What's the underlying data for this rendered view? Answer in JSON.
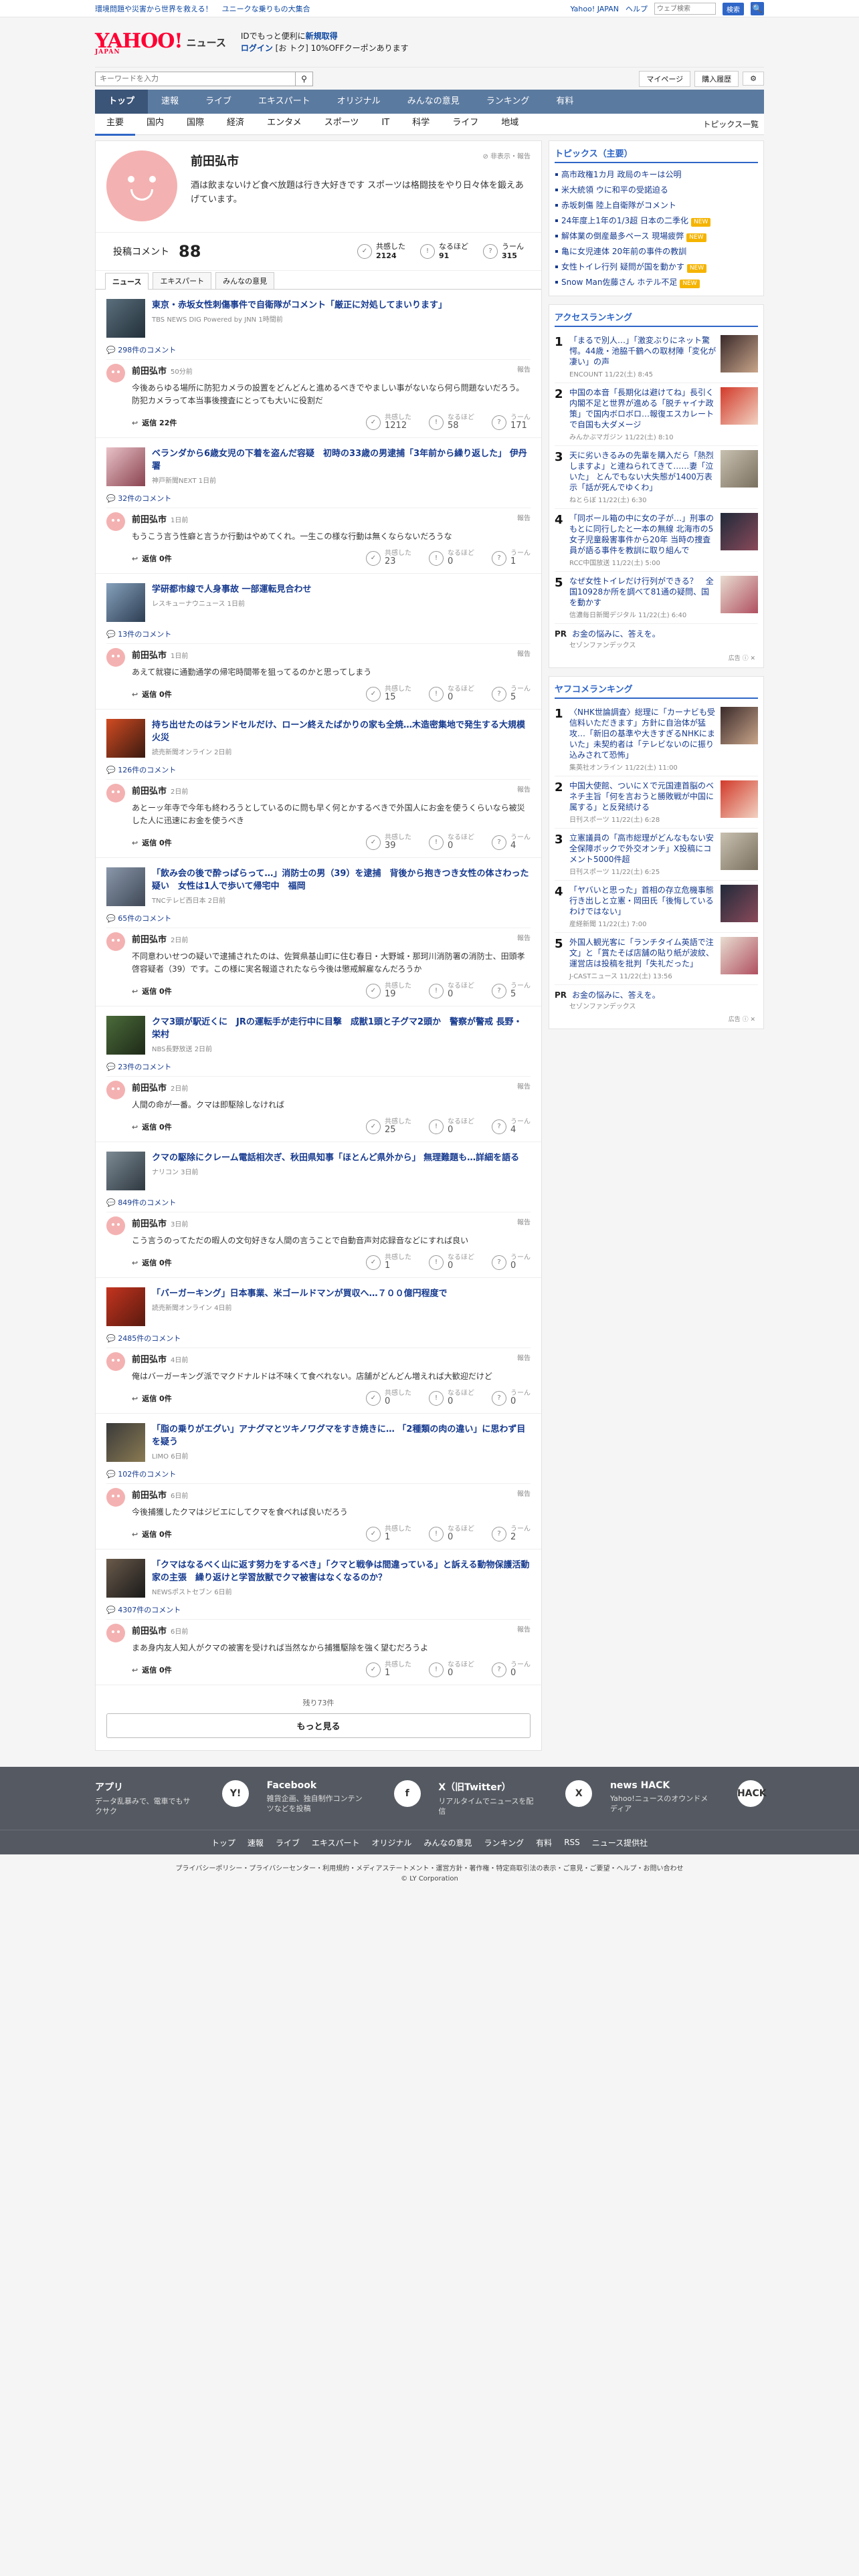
{
  "topbar": {
    "left": [
      "環境問題や災害から世界を救える！",
      "ユニークな乗りもの大集合"
    ],
    "right_links": [
      "Yahoo! JAPAN",
      "ヘルプ"
    ],
    "search_placeholder": "ウェブ検索",
    "search_btn": "検索",
    "search_icon_label": "🔍"
  },
  "masthead": {
    "logo": "YAHOO!",
    "logo_sub": "JAPAN",
    "section": "ニュース",
    "promo_line1_a": "IDでもっと便利に",
    "promo_line1_b": "新規取得",
    "promo_line2_a": "ログイン",
    "promo_line2_b": "[お トク] 10%OFFクーポンあります"
  },
  "search": {
    "placeholder": "キーワードを入力",
    "mypage": "マイページ",
    "history": "購入履歴",
    "gear": "⚙"
  },
  "globalnav": [
    "トップ",
    "速報",
    "ライブ",
    "エキスパート",
    "オリジナル",
    "みんなの意見",
    "ランキング",
    "有料"
  ],
  "subnav": {
    "items": [
      "主要",
      "国内",
      "国際",
      "経済",
      "エンタメ",
      "スポーツ",
      "IT",
      "科学",
      "ライフ",
      "地域"
    ],
    "right": "トピックス一覧"
  },
  "profile": {
    "name": "前田弘市",
    "bio": "酒は飲まないけど食べ放題は行き大好きです スポーツは格闘技をやり日々体を鍛えあげています。",
    "action": "⊘ 非表示・報告"
  },
  "stats": {
    "label": "投稿コメント",
    "count": "88",
    "items": [
      {
        "label": "共感した",
        "value": "2124"
      },
      {
        "label": "なるほど",
        "value": "91"
      },
      {
        "label": "うーん",
        "value": "315"
      }
    ]
  },
  "tabs": [
    "ニュース",
    "エキスパート",
    "みんなの意見"
  ],
  "common": {
    "reply": "返信",
    "report": "報告",
    "react_labels": [
      "共感した",
      "なるほど",
      "うーん"
    ],
    "author": "前田弘市"
  },
  "entries": [
    {
      "title": "東京・赤坂女性刺傷事件で自衛隊がコメント「厳正に対処してまいります」",
      "src": "TBS NEWS DIG Powered by JNN 1時間前",
      "ccount": "298件のコメント",
      "time": "50分前",
      "text": "今後あらゆる場所に防犯カメラの設置をどんどんと進めるべきでやましい事がないなら何ら問題ないだろう。防犯カメラって本当事後捜査にとっても大いに役割だ",
      "reply": "返信 22件",
      "r": [
        "1212",
        "58",
        "171"
      ]
    },
    {
      "title": "ベランダから6歳女児の下着を盗んだ容疑　初時の33歳の男逮捕「3年前から繰り返した」 伊丹署",
      "src": "神戸新聞NEXT 1日前",
      "ccount": "32件のコメント",
      "time": "1日前",
      "text": "もうこう言う性癖と言うか行動はやめてくれ。一生この様な行動は無くならないだろうな",
      "reply": "返信 0件",
      "r": [
        "23",
        "0",
        "1"
      ]
    },
    {
      "title": "学研都市線で人身事故 一部運転見合わせ",
      "src": "レスキューナウニュース 1日前",
      "ccount": "13件のコメント",
      "time": "1日前",
      "text": "あえて就寝に通勤通学の帰宅時間帯を狙ってるのかと思ってしまう",
      "reply": "返信 0件",
      "r": [
        "15",
        "0",
        "5"
      ]
    },
    {
      "title": "持ち出せたのはランドセルだけ、ローン終えたばかりの家も全焼…木造密集地で発生する大規模火災",
      "src": "読売新聞オンライン 2日前",
      "ccount": "126件のコメント",
      "time": "2日前",
      "text": "あとーッ年寺で今年も終わろうとしているのに問も早く何とかするべきで外国人にお金を使うくらいなら被災した人に迅速にお金を使うべき",
      "reply": "返信 0件",
      "r": [
        "39",
        "0",
        "4"
      ]
    },
    {
      "title": "「飲み会の後で酔っぱらって…」消防士の男（39）を逮捕　背後から抱きつき女性の体さわった疑い　女性は1人で歩いて帰宅中　福岡",
      "src": "TNCテレビ西日本 2日前",
      "ccount": "65件のコメント",
      "time": "2日前",
      "text": "不同意わいせつの疑いで逮捕されたのは、佐賀県基山町に住む春日・大野城・那珂川消防署の消防士、田頭孝啓容疑者（39）です。この様に実名報道されたなら今後は懲戒解雇なんだろうか",
      "reply": "返信 0件",
      "r": [
        "19",
        "0",
        "5"
      ]
    },
    {
      "title": "クマ3頭が駅近くに　JRの運転手が走行中に目撃　成獣1頭と子グマ2頭か　警察が警戒 長野・栄村",
      "src": "NBS長野放送 2日前",
      "ccount": "23件のコメント",
      "time": "2日前",
      "text": "人間の命が一番。クマは即駆除しなければ",
      "reply": "返信 0件",
      "r": [
        "25",
        "0",
        "4"
      ]
    },
    {
      "title": "クマの駆除にクレーム電話相次ぎ、秋田県知事「ほとんど県外から」 無理難題も…詳細を語る",
      "src": "ナリコン 3日前",
      "ccount": "849件のコメント",
      "time": "3日前",
      "text": "こう言うのってただの暇人の文句好きな人間の言うことで自動音声対応録音などにすれば良い",
      "reply": "返信 0件",
      "r": [
        "1",
        "0",
        "0"
      ]
    },
    {
      "title": "「バーガーキング」日本事業、米ゴールドマンが買収へ…７００億円程度で",
      "src": "読売新聞オンライン 4日前",
      "ccount": "2485件のコメント",
      "time": "4日前",
      "text": "俺はバーガーキング派でマクドナルドは不味くて食べれない。店舗がどんどん増えれば大歓迎だけど",
      "reply": "返信 0件",
      "r": [
        "0",
        "0",
        "0"
      ]
    },
    {
      "title": "「脂の乗りがエグい」アナグマとツキノワグマをすき焼きに… 「2種類の肉の違い」に思わず目を疑う",
      "src": "LIMO 6日前",
      "ccount": "102件のコメント",
      "time": "6日前",
      "text": "今後捕獲したクマはジビエにしてクマを食べれば良いだろう",
      "reply": "返信 0件",
      "r": [
        "1",
        "0",
        "2"
      ]
    },
    {
      "title": "「クマはなるべく山に返す努力をするべき」「クマと戦争は間違っている」と訴える動物保護活動家の主張　繰り返けと学習放獣でクマ被害はなくなるのか？",
      "src": "NEWSポストセブン 6日前",
      "ccount": "4307件のコメント",
      "time": "6日前",
      "text": "まあ身内友人知人がクマの被害を受ければ当然なから捕獲駆除を強く望むだろうよ",
      "reply": "返信 0件",
      "r": [
        "1",
        "0",
        "0"
      ]
    }
  ],
  "more": {
    "remaining": "残り73件",
    "button": "もっと見る"
  },
  "topics": {
    "title": "トピックス（主要）",
    "items": [
      {
        "t": "高市政権1カ月 政局のキーは公明",
        "b": ""
      },
      {
        "t": "米大統領 ウに和平の受諾迫る",
        "b": ""
      },
      {
        "t": "赤坂刺傷 陸上自衛隊がコメント",
        "b": ""
      },
      {
        "t": "24年度上1年の1/3超 日本の二季化",
        "b": "NEW"
      },
      {
        "t": "解体業の倒産最多ペース 現場疲弊",
        "b": "NEW"
      },
      {
        "t": "亀に女児連体 20年前の事件の教訓",
        "b": ""
      },
      {
        "t": "女性トイレ行列 疑問が国を動かす",
        "b": "NEW"
      },
      {
        "t": "Snow Man佐藤さん ホテル不足",
        "b": "NEW"
      }
    ]
  },
  "access": {
    "title": "アクセスランキング",
    "items": [
      {
        "t": "「まるで別人…」「激変ぶりにネット驚愕。44歳・池脇千鶴への取材陣「変化が凄い」の声",
        "s": "ENCOUNT 11/22(土) 8:45"
      },
      {
        "t": "中国の本音「長期化は避けてね」長引く内閣不足と世界が進める「脱チャイナ政策」で国内ボロボロ…報復エスカレートで自国も大ダメージ",
        "s": "みんかぶマガジン 11/22(土) 8:10"
      },
      {
        "t": "天に劣いきるみの先輩を購入だら「熱烈しますよ」と連ねられてきて……妻「泣いた」 とんでもない大失態が1400万表示「話が死んでゆくわ」",
        "s": "ねとらぼ 11/22(土) 6:30"
      },
      {
        "t": "「同ボール箱の中に女の子が…」刑事のもとに同行したと一本の無線 北海市の5女子児童殺害事件から20年 当時の捜査員が語る事件を教訓に取り組んで",
        "s": "RCC中国放送 11/22(土) 5:00"
      },
      {
        "t": "なぜ女性トイレだけ行列ができる？　全国10928か所を調べて81通の疑問、国を動かす",
        "s": "信濃毎日新聞デジタル 11/22(土) 6:40"
      }
    ]
  },
  "pr": {
    "label": "PR",
    "t": "お金の悩みに、答えを。",
    "s": "セゾンファンデックス",
    "ad": "広告 ⓘ ✕"
  },
  "yahko": {
    "title": "ヤフコメランキング",
    "items": [
      {
        "t": "〈NHK世論調査〉総理に「カーナビも受信料いただきます」方針に自治体が猛攻…「新旧の基準や大きすぎるNHKにまいた」未契約者は「テレビないのに振り込みされて恐怖」",
        "s": "集英社オンライン 11/22(土) 11:00"
      },
      {
        "t": "中国大使館、ついにＸで元国連首脳のベネチ主旨「何を言おうと勝敗戦が中国に属する」と反発続ける",
        "s": "日刊スポーツ 11/22(土) 6:28"
      },
      {
        "t": "立憲議員の「高市総理がどんなもない安全保障ボックで外交オンチ」X投稿にコメント5000件超",
        "s": "日刊スポーツ 11/22(土) 6:25"
      },
      {
        "t": "「ヤバいと思った」首相の存立危機事態行き出しと立憲・岡田氏「後悔しているわけではない」",
        "s": "産経新聞 11/22(土) 7:00"
      },
      {
        "t": "外国人観光客に「ランチタイム英語で注文」と「賞たそば店舗の貼り紙が波紋、運営店は投稿を批判「失礼だった」",
        "s": "J-CASTニュース 11/22(土) 13:56"
      }
    ]
  },
  "footer": {
    "cols": [
      {
        "t": "アプリ",
        "d": "データ乱暴みで、電車でもサクサク",
        "i": "Y!"
      },
      {
        "t": "Facebook",
        "d": "雑貨企画、独自制作コンテンツなどを投稿",
        "i": "f"
      },
      {
        "t": "X（旧Twitter）",
        "d": "リアルタイムでニュースを配信",
        "i": "X"
      },
      {
        "t": "news HACK",
        "d": "Yahoo!ニュースのオウンドメディア",
        "i": "HACK"
      }
    ],
    "nav": [
      "トップ",
      "速報",
      "ライブ",
      "エキスパート",
      "オリジナル",
      "みんなの意見",
      "ランキング",
      "有料",
      "RSS",
      "ニュース提供社"
    ],
    "links": "プライバシーポリシー・プライバシーセンター・利用規約・メディアステートメント・運営方針・著作権・特定商取引法の表示・ご意見・ご要望・ヘルプ・お問い合わせ",
    "copy": "© LY Corporation"
  }
}
